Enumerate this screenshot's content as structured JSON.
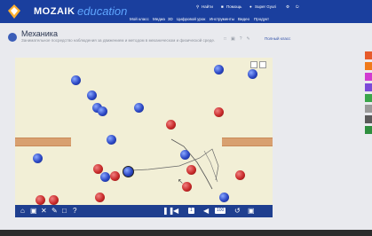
{
  "app": {
    "brand": "MOZAIK",
    "brand_sub": "education"
  },
  "menu": {
    "items": [
      "Мой класс",
      "Медиа",
      "3D",
      "Цифровой урок",
      "Инструменты",
      "Видео",
      "Продукт"
    ]
  },
  "topright": {
    "items": [
      "Найти",
      "Помощь",
      "Super Gyuri"
    ]
  },
  "page": {
    "title": "Механика",
    "subtitle": "Занимательное посредство наблюдения за движением и методом в механическом и физической среде.",
    "lesson_label": "Полный класс"
  },
  "toolbar": {
    "speed_value": "1",
    "zoom_value": "100"
  },
  "colors": {
    "nav": "#1a3f9e",
    "accent": "#5fa6ff",
    "blue_ball": "#2b47c4",
    "red_ball": "#c82a2a",
    "wall": "#d8a070",
    "stage": "#f2efd6"
  },
  "side_tabs": [
    "#e65a2a",
    "#f07a1a",
    "#d13bd1",
    "#7a4ad8",
    "#3aa64a",
    "#9a9a9a",
    "#5a5a5a",
    "#2f8f3f"
  ]
}
